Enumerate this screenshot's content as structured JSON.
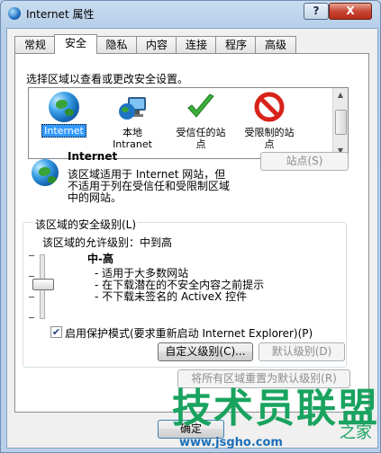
{
  "window": {
    "title": "Internet 属性",
    "help_label": "?",
    "close_label": "X"
  },
  "tabs": [
    "常规",
    "安全",
    "隐私",
    "内容",
    "连接",
    "程序",
    "高级"
  ],
  "zones": {
    "prompt": "选择区域以查看或更改安全设置。",
    "items": [
      {
        "label": "Internet",
        "icon": "globe-icon"
      },
      {
        "label": "本地\nIntranet",
        "icon": "intranet-icon"
      },
      {
        "label": "受信任的站\n点",
        "icon": "check-icon"
      },
      {
        "label": "受限制的站\n点",
        "icon": "restricted-icon"
      }
    ]
  },
  "zone_info": {
    "title": "Internet",
    "line1": "该区域适用于 Internet 网站，但",
    "line2": "不适用于列在受信任和受限制区域",
    "line3": "中的网站。",
    "sites_button": "站点(S)"
  },
  "security": {
    "group_label": "该区域的安全级别(L)",
    "allowed_levels": "该区域的允许级别：中到高",
    "level_title": "中-高",
    "bullets": [
      "- 适用于大多数网站",
      "- 在下载潜在的不安全内容之前提示",
      "- 不下载未签名的 ActiveX 控件"
    ],
    "protected_mode_label": "启用保护模式(要求重新启动 Internet Explorer)(P)",
    "protected_mode_checked": true,
    "custom_level_button": "自定义级别(C)...",
    "default_level_button": "默认级别(D)",
    "slider_value": "中-高"
  },
  "reset_all_button": "将所有区域重置为默认级别(R)",
  "footer": {
    "ok_button": "确定"
  },
  "watermark": {
    "text": "技术员联盟",
    "suffix": "之家",
    "url": "www.jsgho.com"
  },
  "colors": {
    "selection": "#3399ff",
    "check_green": "#3cae3c",
    "restricted_red": "#d8231a",
    "watermark": "#19a35f"
  }
}
